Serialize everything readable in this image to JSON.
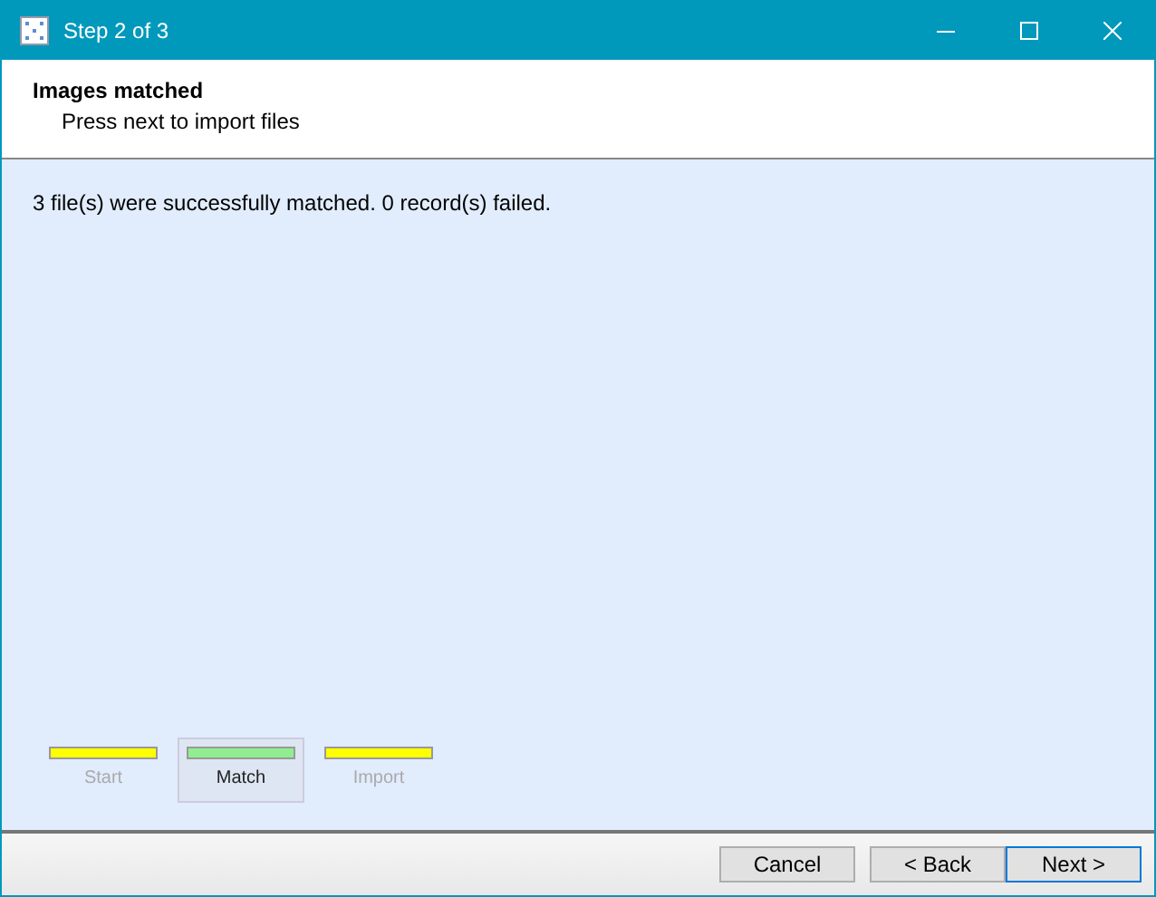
{
  "window": {
    "title": "Step 2 of 3"
  },
  "header": {
    "title": "Images matched",
    "subtitle": "Press next to import files"
  },
  "message": "3 file(s) were successfully matched. 0 record(s) failed.",
  "steps": [
    {
      "label": "Start",
      "color": "#ffff00",
      "selected": false
    },
    {
      "label": "Match",
      "color": "#90ee90",
      "selected": true
    },
    {
      "label": "Import",
      "color": "#ffff00",
      "selected": false
    }
  ],
  "buttons": [
    {
      "label": "Cancel",
      "focused": false
    },
    {
      "label": "< Back",
      "focused": false
    },
    {
      "label": "Next >",
      "focused": true
    }
  ]
}
